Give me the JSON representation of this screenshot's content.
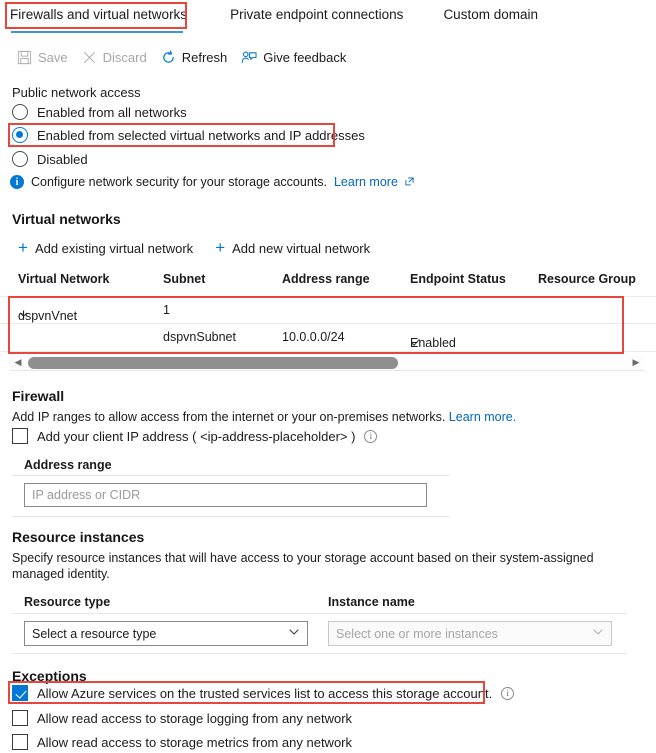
{
  "tabs": [
    {
      "label": "Firewalls and virtual networks",
      "active": true
    },
    {
      "label": "Private endpoint connections",
      "active": false
    },
    {
      "label": "Custom domain",
      "active": false
    }
  ],
  "commandbar": {
    "save": "Save",
    "discard": "Discard",
    "refresh": "Refresh",
    "give_feedback": "Give feedback"
  },
  "public_network_access": {
    "label": "Public network access",
    "options": [
      {
        "label": "Enabled from all networks",
        "selected": false
      },
      {
        "label": "Enabled from selected virtual networks and IP addresses",
        "selected": true
      },
      {
        "label": "Disabled",
        "selected": false
      }
    ],
    "info_text": "Configure network security for your storage accounts.",
    "info_link": "Learn more"
  },
  "virtual_networks": {
    "heading": "Virtual networks",
    "add_existing": "Add existing virtual network",
    "add_new": "Add new virtual network",
    "columns": [
      "Virtual Network",
      "Subnet",
      "Address range",
      "Endpoint Status",
      "Resource Group"
    ],
    "rows": [
      {
        "vnet": "dspvnVnet",
        "subnet_count": "1",
        "address_range": "",
        "endpoint_status": "",
        "resource_group": "",
        "expanded": true
      },
      {
        "vnet": "",
        "subnet_name": "dspvnSubnet",
        "address_range": "10.0.0.0/24",
        "endpoint_status": "Enabled",
        "resource_group": ""
      }
    ]
  },
  "firewall": {
    "heading": "Firewall",
    "description": "Add IP ranges to allow access from the internet or your on-premises networks.",
    "description_link": "Learn more.",
    "client_ip_label": "Add your client IP address ( <ip-address-placeholder> )",
    "client_ip_checked": false,
    "address_range_label": "Address range",
    "address_range_placeholder": "IP address or CIDR",
    "address_range_value": ""
  },
  "resource_instances": {
    "heading": "Resource instances",
    "description": "Specify resource instances that will have access to your storage account based on their system-assigned managed identity.",
    "resource_type_label": "Resource type",
    "resource_type_value": "Select a resource type",
    "instance_name_label": "Instance name",
    "instance_name_value": "Select one or more instances"
  },
  "exceptions": {
    "heading": "Exceptions",
    "items": [
      {
        "label": "Allow Azure services on the trusted services list to access this storage account.",
        "checked": true,
        "has_info": true
      },
      {
        "label": "Allow read access to storage logging from any network",
        "checked": false,
        "has_info": false
      },
      {
        "label": "Allow read access to storage metrics from any network",
        "checked": false,
        "has_info": false
      }
    ]
  },
  "colors": {
    "accent": "#0078d4",
    "highlight": "#e8453c",
    "link": "#0067b8",
    "tab_underline": "#3c96d2"
  }
}
